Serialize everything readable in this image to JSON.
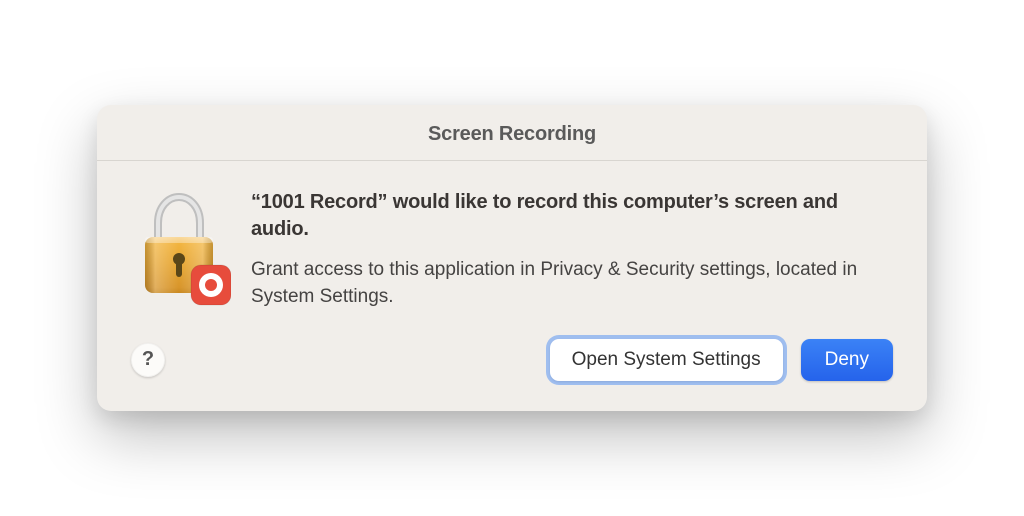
{
  "dialog": {
    "title": "Screen Recording",
    "heading": "“1001 Record” would like to record this computer’s screen and audio.",
    "body": "Grant access to this application in Privacy & Security settings, located in System Settings.",
    "help_label": "?",
    "open_settings_label": "Open System Settings",
    "deny_label": "Deny"
  }
}
